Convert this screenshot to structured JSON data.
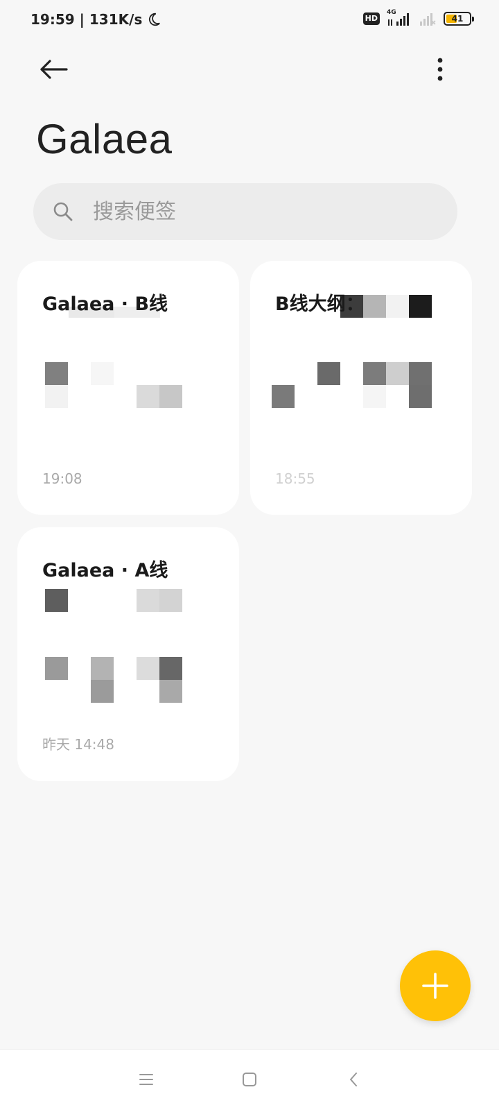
{
  "status_bar": {
    "time_speed": "19:59 | 131K/s",
    "hd_badge": "HD",
    "network_label": "4G",
    "battery_level": "41",
    "icons": [
      "moon-icon",
      "signal-icon",
      "battery-icon"
    ]
  },
  "header": {
    "title": "Galaea",
    "back_icon": "arrow-left-icon",
    "more_icon": "more-vertical-icon"
  },
  "search": {
    "placeholder": "搜索便签",
    "value": ""
  },
  "notes": [
    {
      "title": "Galaea · B线",
      "time": "19:08"
    },
    {
      "title": "B线大纲：",
      "time": "18:55"
    },
    {
      "title": "Galaea · A线",
      "time": "昨天 14:48"
    }
  ],
  "fab": {
    "icon": "plus-icon"
  },
  "nav_bar": {
    "icons": [
      "menu-icon",
      "home-icon",
      "back-icon"
    ]
  },
  "colors": {
    "background": "#f7f7f7",
    "card": "#ffffff",
    "accent": "#ffc107",
    "search_bg": "#ececec"
  }
}
